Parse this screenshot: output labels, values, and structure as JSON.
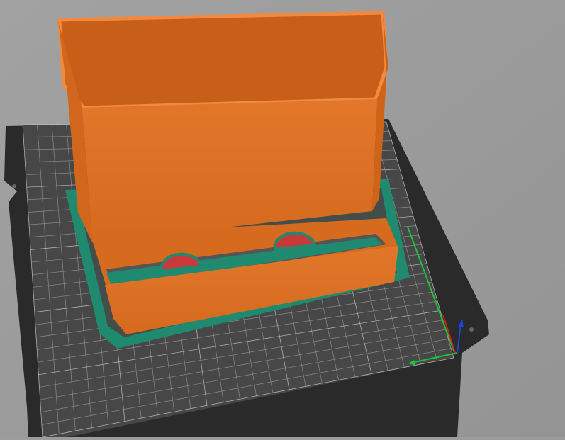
{
  "viewport": {
    "name": "3d-preview",
    "colors": {
      "background": "#9c9c9c",
      "bed_plate": "#2a2a2a",
      "bed_grid": "#4a4a4a",
      "grid_lines": "#8a8a8a",
      "perimeter": "#e07020",
      "perimeter_shade": "#c85f18",
      "skirt_brim": "#1f8a70",
      "solid_infill": "#c83a3a",
      "axis_x": "#d02020",
      "axis_y": "#20c040",
      "axis_z": "#2040e0"
    },
    "icons": [
      "axes-gizmo-icon"
    ]
  }
}
